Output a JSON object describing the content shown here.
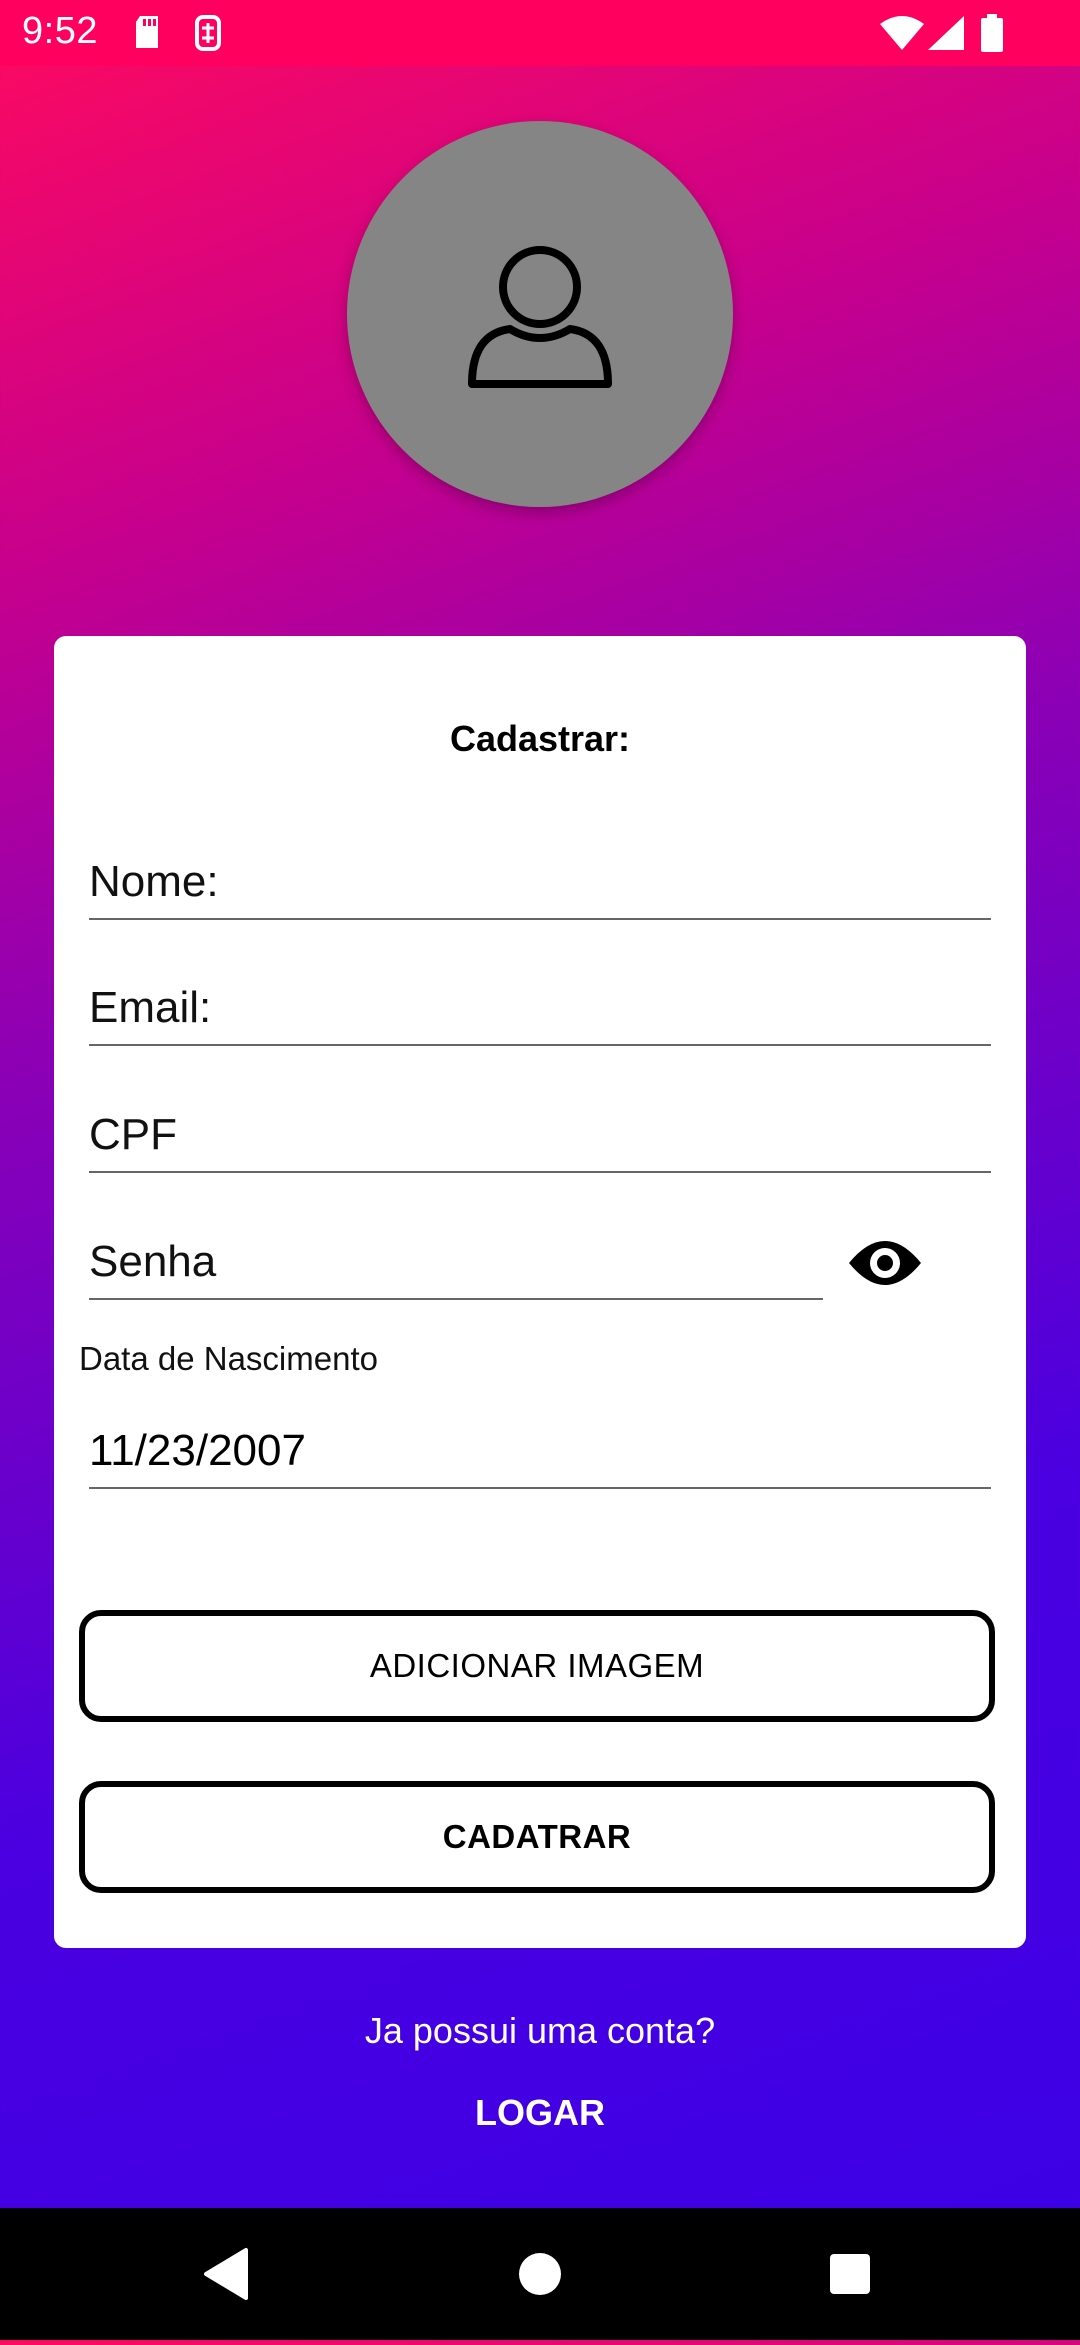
{
  "status_bar": {
    "time": "9:52",
    "icons": [
      "sd-card-icon",
      "sync-icon",
      "wifi-icon",
      "signal-icon",
      "battery-icon"
    ]
  },
  "avatar": {
    "icon": "person-icon"
  },
  "form": {
    "title": "Cadastrar:",
    "name_placeholder": "Nome:",
    "email_placeholder": "Email:",
    "cpf_placeholder": "CPF",
    "password_placeholder": "Senha",
    "password_toggle_icon": "eye-icon",
    "birth_label": "Data de Nascimento",
    "birth_value": "11/23/2007",
    "add_image_label": "ADICIONAR IMAGEM",
    "submit_label": "CADATRAR"
  },
  "footer": {
    "question": "Ja possui uma conta?",
    "login_label": "LOGAR"
  },
  "nav": {
    "icons": [
      "back-icon",
      "home-icon",
      "recents-icon"
    ]
  },
  "colors": {
    "status_bar": "#ff005e",
    "gradient_top": "#ff0a5e",
    "gradient_bottom": "#3a00e6",
    "card": "#ffffff",
    "avatar": "#858585"
  }
}
